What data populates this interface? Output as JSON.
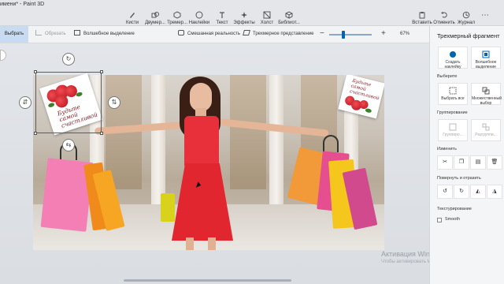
{
  "window": {
    "title": "имени* - Paint 3D"
  },
  "ribbon": {
    "tools": [
      {
        "label": "Кисти",
        "icon": "brush-icon"
      },
      {
        "label": "Двумер...",
        "icon": "2d-shapes-icon"
      },
      {
        "label": "Тремер...",
        "icon": "3d-shapes-icon"
      },
      {
        "label": "Наклейки",
        "icon": "stickers-icon"
      },
      {
        "label": "Текст",
        "icon": "text-icon"
      },
      {
        "label": "Эффекты",
        "icon": "effects-icon"
      },
      {
        "label": "Холст",
        "icon": "canvas-icon"
      },
      {
        "label": "Библиот...",
        "icon": "library-icon"
      }
    ],
    "right": [
      {
        "label": "Вставить",
        "icon": "paste-icon"
      },
      {
        "label": "Отменить",
        "icon": "undo-icon"
      },
      {
        "label": "Журнал",
        "icon": "history-icon"
      }
    ]
  },
  "toolbar": {
    "select_label": "Выбрать",
    "crop_label": "Обрезать",
    "magic_select_label": "Волшебное выделение",
    "mixed_reality_label": "Смешанная реальность",
    "3d_view_label": "Трехмерное представление",
    "zoom_level": "67%",
    "zoom_minus": "−",
    "zoom_plus": "+",
    "zoom_fraction": 0.3
  },
  "canvas": {
    "sticker_left_text": [
      "Будьте",
      "самой",
      "счастливой"
    ],
    "sticker_right_text": [
      "Будьте",
      "самой",
      "счастливой"
    ]
  },
  "panel": {
    "title": "Трехмерный фрагмент",
    "top_buttons": [
      {
        "label": "Создать наклейку",
        "icon": "make-sticker-icon"
      },
      {
        "label": "Волшебное выделение",
        "icon": "magic-select-icon"
      }
    ],
    "select_section": "Выберите",
    "select_buttons": [
      {
        "label": "Выбрать все",
        "icon": "select-all-icon"
      },
      {
        "label": "Множественный выбор",
        "icon": "multi-select-icon"
      }
    ],
    "group_section": "Группирование",
    "group_buttons": [
      {
        "label": "Группиро...",
        "icon": "group-icon"
      },
      {
        "label": "Разгруппи...",
        "icon": "ungroup-icon"
      }
    ],
    "edit_section": "Изменить",
    "edit_icons": [
      "cut-icon",
      "copy-icon",
      "paste-icon",
      "delete-icon"
    ],
    "rotate_section": "Повернуть и отразить",
    "rotate_icons": [
      "rotate-left-icon",
      "rotate-right-icon",
      "flip-horizontal-icon",
      "flip-vertical-icon"
    ],
    "texture_section": "Текстурирование",
    "smooth_label": "Smooth"
  },
  "watermark": {
    "line1": "Активация Windows",
    "line2": "Чтобы активировать Windows, перейдите в"
  },
  "colors": {
    "accent": "#0063b1",
    "select_bg": "#c9dbf1",
    "dress": "#e8303b"
  }
}
